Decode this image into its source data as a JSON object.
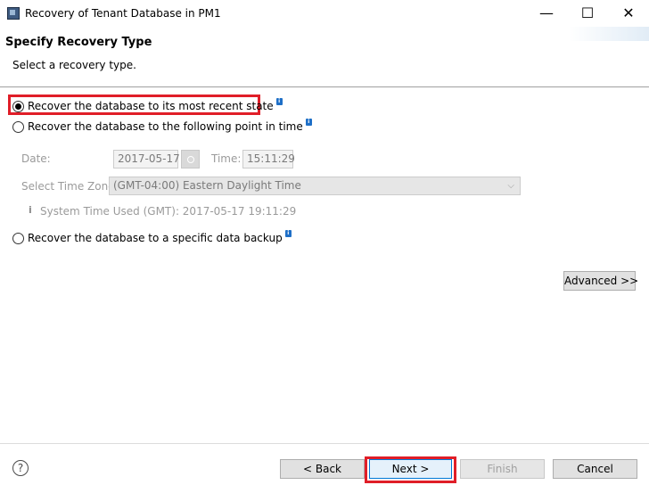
{
  "window": {
    "title": "Recovery of Tenant Database in PM1",
    "min_glyph": "—",
    "max_glyph": "☐",
    "close_glyph": "✕"
  },
  "header": {
    "title": "Specify Recovery Type",
    "subtitle": "Select a recovery type."
  },
  "options": {
    "most_recent": {
      "label": "Recover the database to its most recent state",
      "checked": true
    },
    "point_in_time": {
      "label": "Recover the database to the following point in time",
      "checked": false
    },
    "data_backup": {
      "label": "Recover the database to a specific data backup",
      "checked": false
    },
    "info_badge": "i"
  },
  "point_in_time": {
    "date_label": "Date:",
    "date_value": "2017-05-17",
    "time_label": "Time:",
    "time_value": "15:11:29",
    "timezone_label": "Select Time Zone:",
    "timezone_value": "(GMT-04:00) Eastern Daylight Time",
    "system_time_icon": "i",
    "system_time": "System Time Used (GMT): 2017-05-17 19:11:29"
  },
  "buttons": {
    "advanced": "Advanced >>",
    "back": "< Back",
    "next": "Next >",
    "finish": "Finish",
    "cancel": "Cancel",
    "help": "?"
  },
  "colors": {
    "highlight": "#e01e28",
    "info_badge": "#1e6fc7"
  }
}
